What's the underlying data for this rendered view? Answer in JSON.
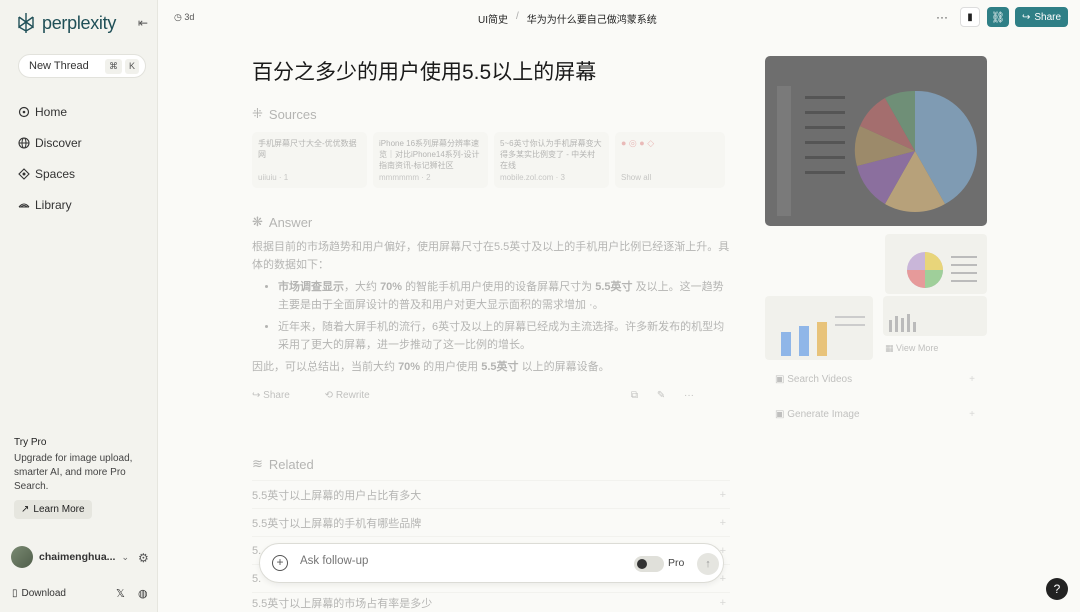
{
  "app": {
    "name": "perplexity"
  },
  "sidebar": {
    "new_thread": "New Thread",
    "shortcut": [
      "⌘",
      "K"
    ],
    "items": [
      {
        "label": "Home",
        "icon": "home-icon"
      },
      {
        "label": "Discover",
        "icon": "globe-icon"
      },
      {
        "label": "Spaces",
        "icon": "spaces-icon"
      },
      {
        "label": "Library",
        "icon": "library-icon"
      }
    ],
    "trypro": {
      "title": "Try Pro",
      "desc": "Upgrade for image upload, smarter AI, and more Pro Search.",
      "button": "Learn More"
    },
    "user": "chaimenghua...",
    "download": "Download"
  },
  "header": {
    "age": "3d",
    "breadcrumb": [
      "UI简史",
      "华为为什么要自己做鸿蒙系统"
    ],
    "share": "Share"
  },
  "main": {
    "title": "百分之多少的用户使用5.5以上的屏幕",
    "sources_label": "Sources",
    "sources": [
      {
        "title": "手机屏幕尺寸大全-优优数据网",
        "site": "uiiuiu",
        "num": "1"
      },
      {
        "title": "iPhone 16系列屏幕分辨率速览｜对比iPhone14系列-设计指南资讯-标记狮社区",
        "site": "mmmmmm",
        "num": "2"
      },
      {
        "title": "5~6英寸你认为手机屏幕变大得多某实比例变了 - 中关村在线",
        "site": "mobile.zol.com",
        "num": "3"
      }
    ],
    "show_all": "Show all",
    "answer_label": "Answer",
    "answer_intro": "根据目前的市场趋势和用户偏好，使用屏幕尺寸在5.5英寸及以上的手机用户比例已经逐渐上升。具体的数据如下：",
    "bullet1_bold": "市场调查显示",
    "bullet1_mid": "，大约 ",
    "bullet1_pct": "70%",
    "bullet1_rest": " 的智能手机用户使用的设备屏幕尺寸为 ",
    "bullet1_size": "5.5英寸",
    "bullet1_end": " 及以上。这一趋势主要是由于全面屏设计的普及和用户对更大显示面积的需求增加",
    "bullet2": "近年来，随着大屏手机的流行，6英寸及以上的屏幕已经成为主流选择。许多新发布的机型均采用了更大的屏幕，进一步推动了这一比例的增长。",
    "conclusion_a": "因此，可以总结出，当前大约 ",
    "conclusion_pct": "70%",
    "conclusion_b": " 的用户使用 ",
    "conclusion_size": "5.5英寸",
    "conclusion_c": " 以上的屏幕设备。",
    "action_share": "Share",
    "action_rewrite": "Rewrite",
    "related_label": "Related",
    "related": [
      "5.5英寸以上屏幕的用户占比有多大",
      "5.5英寸以上屏幕的手机有哪些品牌",
      "5.",
      "5.",
      "5.5英寸以上屏幕的市场占有率是多少"
    ],
    "followup_placeholder": "Ask follow-up",
    "pro_label": "Pro"
  },
  "right": {
    "view_more": "View More",
    "search_videos": "Search Videos",
    "generate_image": "Generate Image"
  }
}
